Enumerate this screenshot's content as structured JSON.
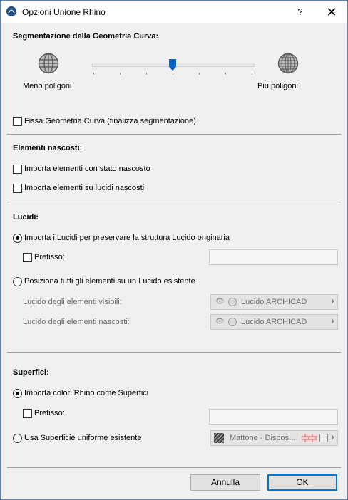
{
  "window": {
    "title": "Opzioni Unione Rhino",
    "help_label": "?",
    "close_label": "✕"
  },
  "segmentation": {
    "heading": "Segmentazione della Geometria Curva:",
    "min_label": "Meno poligoni",
    "max_label": "Più poligoni",
    "slider_value": 0.5,
    "fix_label": "Fissa Geometria Curva (finalizza segmentazione)",
    "fix_checked": false
  },
  "hidden": {
    "heading": "Elementi nascosti:",
    "import_hidden_state": "Importa elementi con stato nascosto",
    "import_hidden_layers": "Importa elementi su lucidi nascosti"
  },
  "layers": {
    "heading": "Lucidi:",
    "import_option": "Importa i Lucidi per preservare la struttura Lucido originaria",
    "prefix_label": "Prefisso:",
    "prefix_value": "",
    "place_option": "Posiziona tutti gli elementi su un Lucido esistente",
    "visible_label": "Lucido degli elementi visibili:",
    "hidden_label": "Lucido degli elementi nascosti:",
    "visible_value": "Lucido ARCHICAD",
    "hidden_value": "Lucido ARCHICAD"
  },
  "surfaces": {
    "heading": "Superfici:",
    "import_option": "Importa colori Rhino come Superfici",
    "prefix_label": "Prefisso:",
    "prefix_value": "",
    "uniform_option": "Usa Superficie uniforme esistente",
    "surface_value": "Mattone - Dispos..."
  },
  "buttons": {
    "cancel": "Annulla",
    "ok": "OK"
  },
  "icons": {
    "app": "archicad-icon",
    "globe": "globe-icon",
    "eye": "eye-icon",
    "layer": "layer-icon",
    "surface": "surface-swatch-icon"
  }
}
